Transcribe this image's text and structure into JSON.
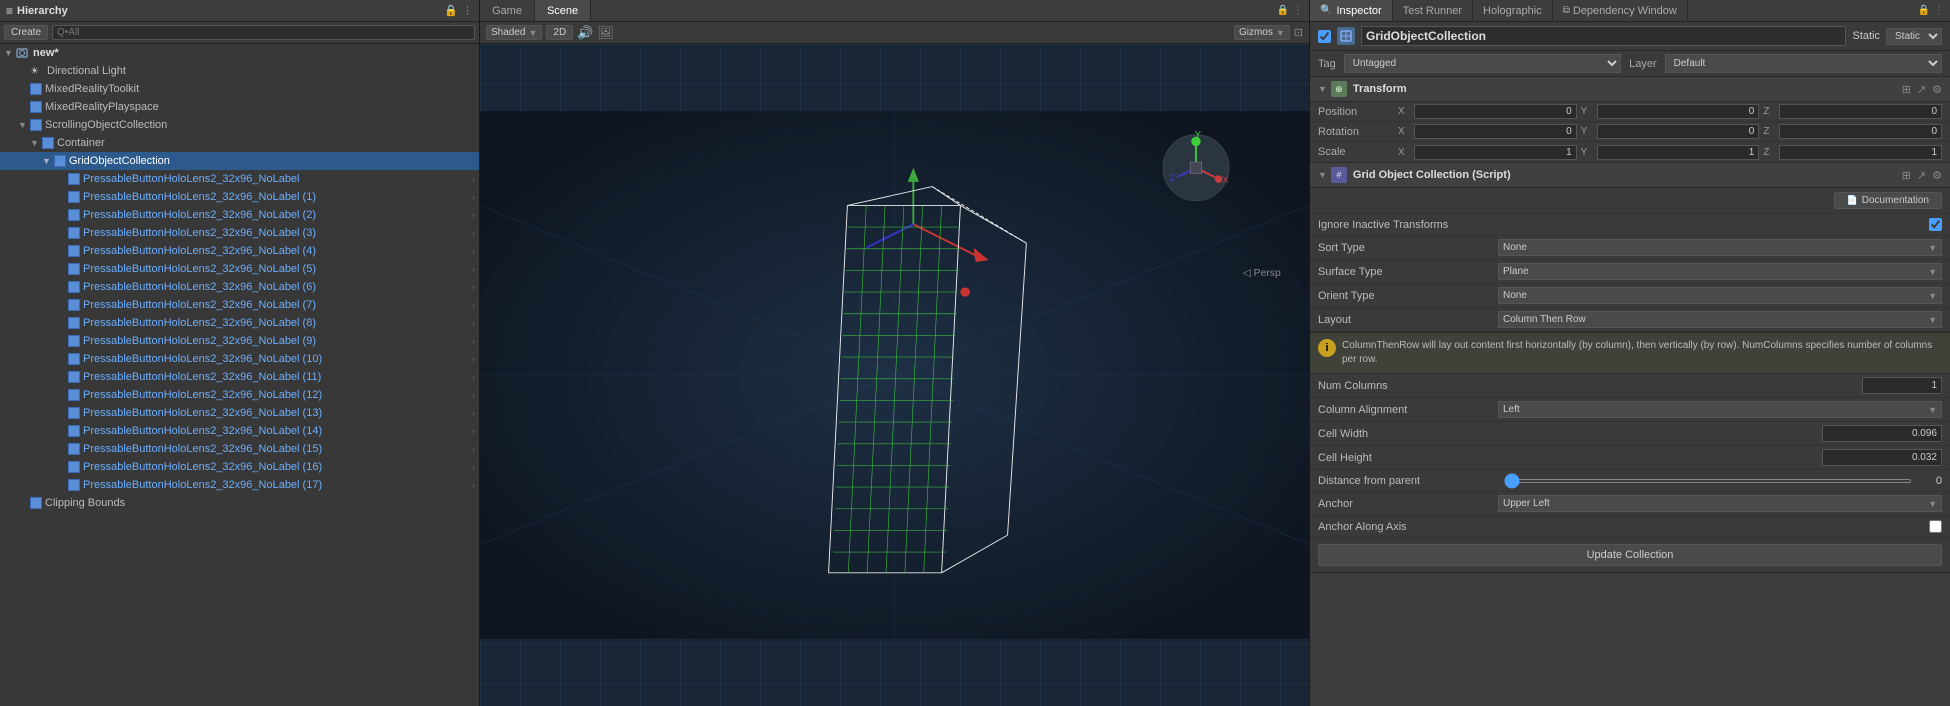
{
  "topTabs": [
    {
      "id": "hierarchy",
      "label": "Hierarchy",
      "icon": "≡",
      "active": true
    },
    {
      "id": "game",
      "label": "Game",
      "icon": "",
      "active": false
    },
    {
      "id": "scene",
      "label": "Scene",
      "icon": "",
      "active": true
    },
    {
      "id": "inspector",
      "label": "Inspector",
      "icon": "",
      "active": true
    },
    {
      "id": "testRunner",
      "label": "Test Runner",
      "active": false
    },
    {
      "id": "holographic",
      "label": "Holographic",
      "active": false
    },
    {
      "id": "dependencyWindow",
      "label": "Dependency Window",
      "icon": "⧉",
      "active": false
    }
  ],
  "hierarchy": {
    "title": "Hierarchy",
    "createLabel": "Create",
    "searchPlaceholder": "Q•All",
    "items": [
      {
        "id": "new",
        "label": "new*",
        "depth": 0,
        "hasArrow": true,
        "bold": true,
        "icon": "scene"
      },
      {
        "id": "dirLight",
        "label": "Directional Light",
        "depth": 1,
        "hasArrow": false,
        "icon": "light"
      },
      {
        "id": "mrToolkit",
        "label": "MixedRealityToolkit",
        "depth": 1,
        "hasArrow": false,
        "icon": "cube"
      },
      {
        "id": "mrPlayspace",
        "label": "MixedRealityPlayspace",
        "depth": 1,
        "hasArrow": false,
        "icon": "cube"
      },
      {
        "id": "scrollingObjColl",
        "label": "ScrollingObjectCollection",
        "depth": 1,
        "hasArrow": true,
        "icon": "cube"
      },
      {
        "id": "container",
        "label": "Container",
        "depth": 2,
        "hasArrow": true,
        "icon": "cube"
      },
      {
        "id": "gridObjColl",
        "label": "GridObjectCollection",
        "depth": 3,
        "hasArrow": true,
        "icon": "cube",
        "selected": true
      },
      {
        "id": "btn0",
        "label": "PressableButtonHoloLens2_32x96_NoLabel",
        "depth": 4,
        "hasArrow": false,
        "icon": "cube",
        "blue": true,
        "hasChevron": true
      },
      {
        "id": "btn1",
        "label": "PressableButtonHoloLens2_32x96_NoLabel (1)",
        "depth": 4,
        "hasArrow": false,
        "icon": "cube",
        "blue": true,
        "hasChevron": true
      },
      {
        "id": "btn2",
        "label": "PressableButtonHoloLens2_32x96_NoLabel (2)",
        "depth": 4,
        "hasArrow": false,
        "icon": "cube",
        "blue": true,
        "hasChevron": true
      },
      {
        "id": "btn3",
        "label": "PressableButtonHoloLens2_32x96_NoLabel (3)",
        "depth": 4,
        "hasArrow": false,
        "icon": "cube",
        "blue": true,
        "hasChevron": true
      },
      {
        "id": "btn4",
        "label": "PressableButtonHoloLens2_32x96_NoLabel (4)",
        "depth": 4,
        "hasArrow": false,
        "icon": "cube",
        "blue": true,
        "hasChevron": true
      },
      {
        "id": "btn5",
        "label": "PressableButtonHoloLens2_32x96_NoLabel (5)",
        "depth": 4,
        "hasArrow": false,
        "icon": "cube",
        "blue": true,
        "hasChevron": true
      },
      {
        "id": "btn6",
        "label": "PressableButtonHoloLens2_32x96_NoLabel (6)",
        "depth": 4,
        "hasArrow": false,
        "icon": "cube",
        "blue": true,
        "hasChevron": true
      },
      {
        "id": "btn7",
        "label": "PressableButtonHoloLens2_32x96_NoLabel (7)",
        "depth": 4,
        "hasArrow": false,
        "icon": "cube",
        "blue": true,
        "hasChevron": true
      },
      {
        "id": "btn8",
        "label": "PressableButtonHoloLens2_32x96_NoLabel (8)",
        "depth": 4,
        "hasArrow": false,
        "icon": "cube",
        "blue": true,
        "hasChevron": true
      },
      {
        "id": "btn9",
        "label": "PressableButtonHoloLens2_32x96_NoLabel (9)",
        "depth": 4,
        "hasArrow": false,
        "icon": "cube",
        "blue": true,
        "hasChevron": true
      },
      {
        "id": "btn10",
        "label": "PressableButtonHoloLens2_32x96_NoLabel (10)",
        "depth": 4,
        "hasArrow": false,
        "icon": "cube",
        "blue": true,
        "hasChevron": true
      },
      {
        "id": "btn11",
        "label": "PressableButtonHoloLens2_32x96_NoLabel (11)",
        "depth": 4,
        "hasArrow": false,
        "icon": "cube",
        "blue": true,
        "hasChevron": true
      },
      {
        "id": "btn12",
        "label": "PressableButtonHoloLens2_32x96_NoLabel (12)",
        "depth": 4,
        "hasArrow": false,
        "icon": "cube",
        "blue": true,
        "hasChevron": true
      },
      {
        "id": "btn13",
        "label": "PressableButtonHoloLens2_32x96_NoLabel (13)",
        "depth": 4,
        "hasArrow": false,
        "icon": "cube",
        "blue": true,
        "hasChevron": true
      },
      {
        "id": "btn14",
        "label": "PressableButtonHoloLens2_32x96_NoLabel (14)",
        "depth": 4,
        "hasArrow": false,
        "icon": "cube",
        "blue": true,
        "hasChevron": true
      },
      {
        "id": "btn15",
        "label": "PressableButtonHoloLens2_32x96_NoLabel (15)",
        "depth": 4,
        "hasArrow": false,
        "icon": "cube",
        "blue": true,
        "hasChevron": true
      },
      {
        "id": "btn16",
        "label": "PressableButtonHoloLens2_32x96_NoLabel (16)",
        "depth": 4,
        "hasArrow": false,
        "icon": "cube",
        "blue": true,
        "hasChevron": true
      },
      {
        "id": "btn17",
        "label": "PressableButtonHoloLens2_32x96_NoLabel (17)",
        "depth": 4,
        "hasArrow": false,
        "icon": "cube",
        "blue": true,
        "hasChevron": true
      },
      {
        "id": "clipping",
        "label": "Clipping Bounds",
        "depth": 1,
        "hasArrow": false,
        "icon": "cube"
      }
    ]
  },
  "viewport": {
    "gameTabLabel": "Game",
    "sceneTabLabel": "Scene",
    "shadingLabel": "Shaded",
    "twoDLabel": "2D",
    "gizmosLabel": "Gizmos",
    "perspLabel": "Persp"
  },
  "inspector": {
    "title": "Inspector",
    "testRunnerLabel": "Test Runner",
    "holographicLabel": "Holographic",
    "dependencyWindowLabel": "Dependency Window",
    "objectName": "GridObjectCollection",
    "staticLabel": "Static",
    "tag": {
      "label": "Tag",
      "value": "Untagged"
    },
    "layer": {
      "label": "Layer",
      "value": "Default"
    },
    "transform": {
      "title": "Transform",
      "position": {
        "label": "Position",
        "x": "0",
        "y": "0",
        "z": "0"
      },
      "rotation": {
        "label": "Rotation",
        "x": "0",
        "y": "0",
        "z": "0"
      },
      "scale": {
        "label": "Scale",
        "x": "1",
        "y": "1",
        "z": "1"
      }
    },
    "gridObjectCollection": {
      "title": "Grid Object Collection (Script)",
      "documentationLabel": "Documentation",
      "props": [
        {
          "id": "ignoreInactive",
          "label": "Ignore Inactive Transforms",
          "type": "checkbox",
          "checked": true
        },
        {
          "id": "sortType",
          "label": "Sort Type",
          "type": "dropdown",
          "value": "None"
        },
        {
          "id": "surfaceType",
          "label": "Surface Type",
          "type": "dropdown",
          "value": "Plane"
        },
        {
          "id": "orientType",
          "label": "Orient Type",
          "type": "dropdown",
          "value": "None"
        },
        {
          "id": "layout",
          "label": "Layout",
          "type": "dropdown",
          "value": "Column Then Row"
        }
      ],
      "infoText": "ColumnThenRow will lay out content first horizontally (by column), then vertically (by row). NumColumns specifies number of columns per row.",
      "numColumns": {
        "label": "Num Columns",
        "value": "1"
      },
      "columnAlignment": {
        "label": "Column Alignment",
        "value": "Left"
      },
      "cellWidth": {
        "label": "Cell Width",
        "value": "0.096"
      },
      "cellHeight": {
        "label": "Cell Height",
        "value": "0.032"
      },
      "distanceFromParent": {
        "label": "Distance from parent",
        "sliderValue": 0,
        "displayValue": "0"
      },
      "anchor": {
        "label": "Anchor",
        "value": "Upper Left"
      },
      "anchorAlongAxis": {
        "label": "Anchor Along Axis",
        "checked": false
      },
      "updateCollectionLabel": "Update Collection"
    }
  },
  "colors": {
    "accent": "#4a9eff",
    "selected": "#2c5a8c",
    "panelBg": "#3c3c3c",
    "headerBg": "#404040",
    "borderColor": "#222"
  }
}
